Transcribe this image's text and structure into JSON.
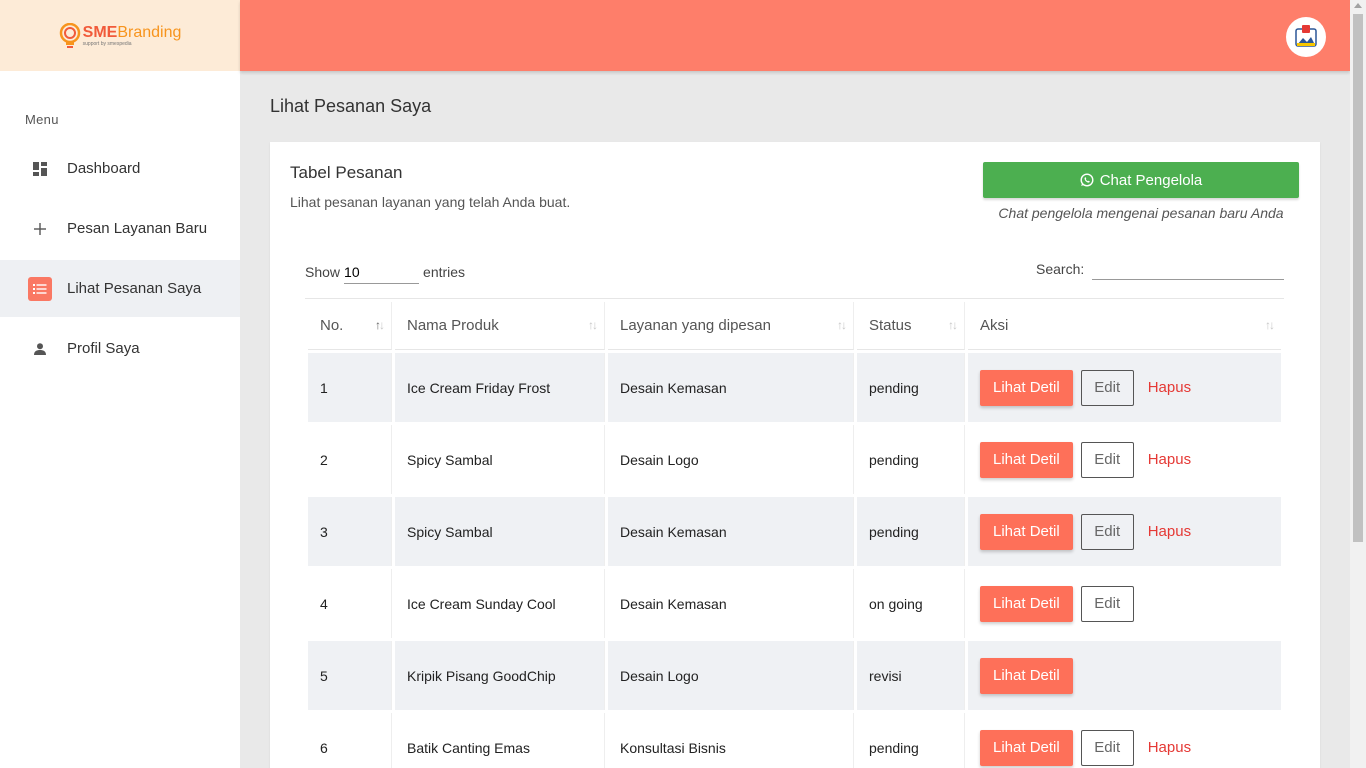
{
  "brand": {
    "name_part1": "SME",
    "name_part2": "Branding",
    "tagline": "support by smespedia"
  },
  "sidebar": {
    "menu_title": "Menu",
    "items": [
      {
        "label": "Dashboard",
        "icon": "dashboard-icon",
        "active": false
      },
      {
        "label": "Pesan Layanan Baru",
        "icon": "plus-icon",
        "active": false
      },
      {
        "label": "Lihat Pesanan Saya",
        "icon": "list-icon",
        "active": true
      },
      {
        "label": "Profil Saya",
        "icon": "person-icon",
        "active": false
      }
    ]
  },
  "page": {
    "title": "Lihat Pesanan Saya"
  },
  "card": {
    "title": "Tabel Pesanan",
    "subtitle": "Lihat pesanan layanan yang telah Anda buat.",
    "chat_button": "Chat Pengelola",
    "chat_note": "Chat pengelola mengenai pesanan baru Anda"
  },
  "controls": {
    "show_label": "Show",
    "entries_value": "10",
    "entries_label": "entries",
    "search_label": "Search:"
  },
  "table": {
    "columns": [
      "No.",
      "Nama Produk",
      "Layanan yang dipesan",
      "Status",
      "Aksi"
    ],
    "rows": [
      {
        "no": "1",
        "product": "Ice Cream Friday Frost",
        "service": "Desain Kemasan",
        "status": "pending",
        "actions": [
          "detail",
          "edit",
          "delete"
        ]
      },
      {
        "no": "2",
        "product": "Spicy Sambal",
        "service": "Desain Logo",
        "status": "pending",
        "actions": [
          "detail",
          "edit",
          "delete"
        ]
      },
      {
        "no": "3",
        "product": "Spicy Sambal",
        "service": "Desain Kemasan",
        "status": "pending",
        "actions": [
          "detail",
          "edit",
          "delete"
        ]
      },
      {
        "no": "4",
        "product": "Ice Cream Sunday Cool",
        "service": "Desain Kemasan",
        "status": "on going",
        "actions": [
          "detail",
          "edit"
        ]
      },
      {
        "no": "5",
        "product": "Kripik Pisang GoodChip",
        "service": "Desain Logo",
        "status": "revisi",
        "actions": [
          "detail"
        ]
      },
      {
        "no": "6",
        "product": "Batik Canting Emas",
        "service": "Konsultasi Bisnis",
        "status": "pending",
        "actions": [
          "detail",
          "edit",
          "delete"
        ]
      }
    ],
    "action_labels": {
      "detail": "Lihat Detil",
      "edit": "Edit",
      "delete": "Hapus"
    }
  },
  "colors": {
    "topbar": "#fe7e6a",
    "accent": "#fe7059",
    "chat": "#4caf50",
    "logo_bg": "#fdebd7",
    "delete": "#e53935"
  }
}
